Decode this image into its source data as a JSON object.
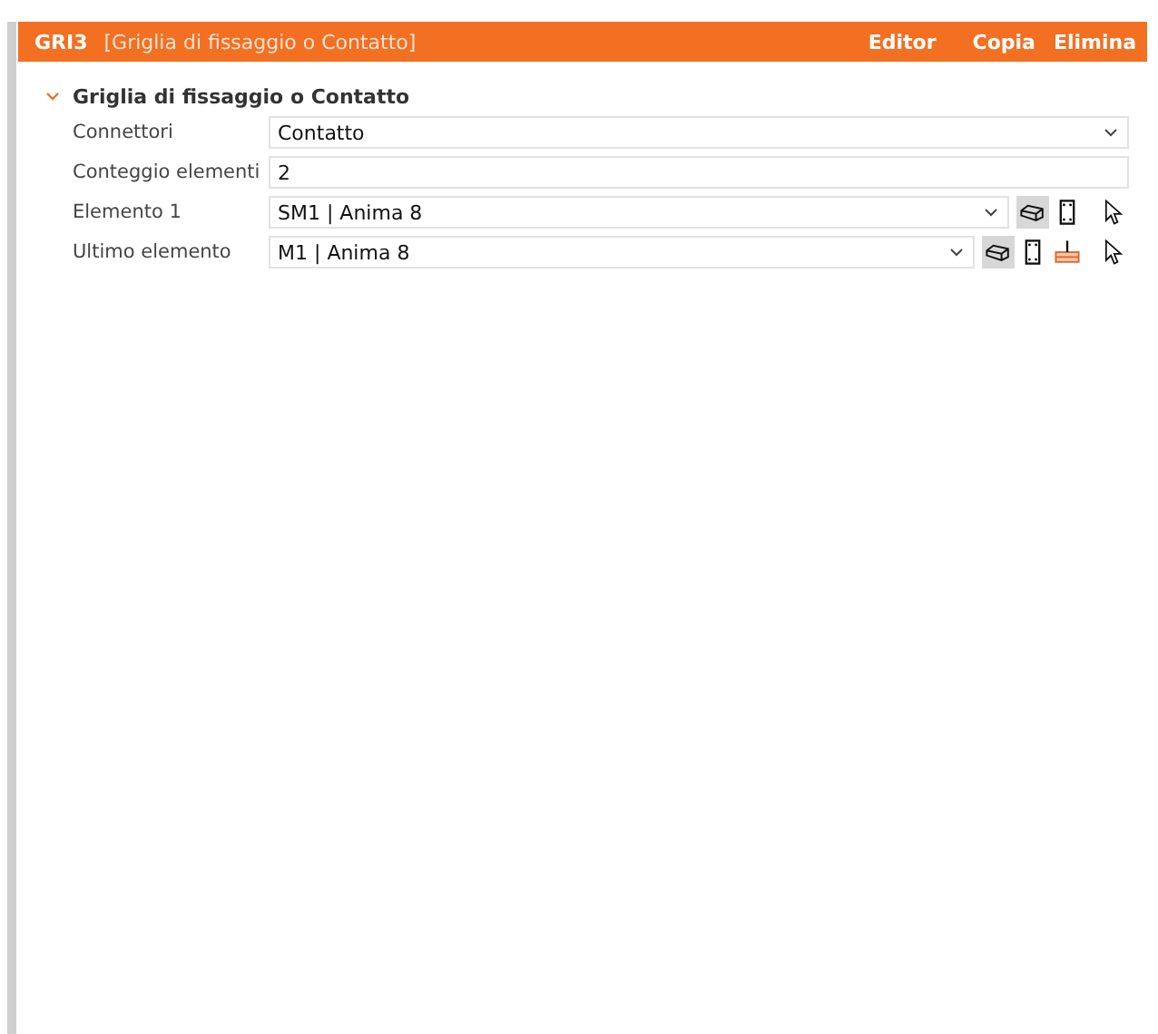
{
  "header": {
    "code": "GRI3",
    "title": "[Griglia di fissaggio o Contatto]",
    "actions": [
      "Editor",
      "Copia",
      "Elimina"
    ]
  },
  "section": {
    "title": "Griglia di fissaggio o Contatto",
    "expanded": true,
    "rows": [
      {
        "label": "Connettori",
        "kind": "select",
        "value": "Contatto"
      },
      {
        "label": "Conteggio elementi",
        "kind": "input",
        "value": "2"
      },
      {
        "label": "Elemento 1",
        "kind": "select",
        "value": "SM1 | Anima 8",
        "tools": [
          {
            "kind": "solid",
            "selected": true
          },
          {
            "kind": "section",
            "selected": false
          },
          {
            "kind": "pick",
            "selected": false
          }
        ]
      },
      {
        "label": "Ultimo elemento",
        "kind": "select",
        "value": "M1 | Anima 8",
        "tools": [
          {
            "kind": "solid",
            "selected": true
          },
          {
            "kind": "section",
            "selected": false
          },
          {
            "kind": "footing",
            "selected": false
          },
          {
            "kind": "pick",
            "selected": false
          }
        ]
      }
    ]
  }
}
